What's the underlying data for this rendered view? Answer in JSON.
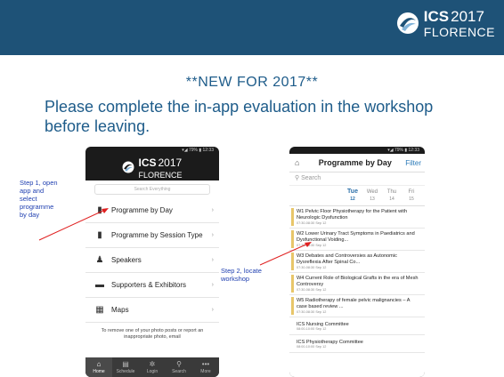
{
  "header": {
    "logo_ics": "ICS",
    "logo_year": "2017",
    "logo_city": "FLORENCE"
  },
  "headline": "**NEW FOR 2017**",
  "subline": "Please complete the in-app evaluation in the workshop before leaving.",
  "step1": "Step 1, open app and select programme by day",
  "step2": "Step 2, locate workshop",
  "phone1": {
    "search_placeholder": "Search Everything",
    "menu": [
      {
        "label": "Programme by Day",
        "icon": "book-icon"
      },
      {
        "label": "Programme by Session Type",
        "icon": "book-icon"
      },
      {
        "label": "Speakers",
        "icon": "person-icon"
      },
      {
        "label": "Supporters & Exhibitors",
        "icon": "monitor-icon"
      },
      {
        "label": "Maps",
        "icon": "map-icon"
      }
    ],
    "note": "To remove one of your photo posts or report an inappropriate photo, email",
    "tabs": [
      "Home",
      "Schedule",
      "Login",
      "Search",
      "More"
    ]
  },
  "phone2": {
    "title": "Programme by Day",
    "filter": "Filter",
    "search": "Search",
    "days": [
      {
        "name": "Tue",
        "num": "12"
      },
      {
        "name": "Wed",
        "num": "13"
      },
      {
        "name": "Thu",
        "num": "14"
      },
      {
        "name": "Fri",
        "num": "15"
      }
    ],
    "sessions": [
      {
        "title": "W1 Pelvic Floor Physiotherapy for the Patient with Neurologic Dysfunction",
        "meta": "07:30-08:30 Sep 12"
      },
      {
        "title": "W2 Lower Urinary Tract Symptoms in Paediatrics and Dysfunctional Voiding...",
        "meta": "07:30-08:30 Sep 12"
      },
      {
        "title": "W3 Debates and Controversies as Autonomic Dysreflexia After Spinal Co...",
        "meta": "07:30-08:30 Sep 12"
      },
      {
        "title": "W4 Current Role of Biological Grafts in the era of Mesh Controversy",
        "meta": "07:30-08:30 Sep 12"
      },
      {
        "title": "W5 Radiotherapy of female pelvic malignancies – A case based review ...",
        "meta": "07:30-08:30 Sep 12"
      }
    ],
    "committees": [
      {
        "title": "ICS Nursing Committee",
        "meta": "08:00-10:00 Sep 12"
      },
      {
        "title": "ICS Physiotherapy Committee",
        "meta": "08:00-10:00 Sep 12"
      }
    ]
  }
}
